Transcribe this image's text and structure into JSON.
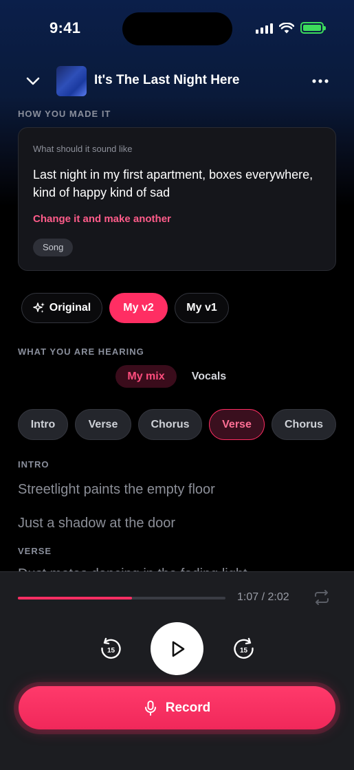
{
  "status_bar": {
    "time": "9:41"
  },
  "header": {
    "title": "It's The Last Night Here"
  },
  "how_you_made_it": {
    "label": "HOW YOU MADE IT",
    "question": "What should it sound like",
    "prompt": "Last night in my first apartment, boxes everywhere, kind of happy kind of sad",
    "change_link": "Change it and make another",
    "tag": "Song"
  },
  "versions": [
    {
      "label": "Original",
      "active": false
    },
    {
      "label": "My v2",
      "active": true
    },
    {
      "label": "My v1",
      "active": false
    }
  ],
  "hearing": {
    "label": "WHAT YOU ARE HEARING",
    "options": [
      {
        "label": "My mix",
        "active": true
      },
      {
        "label": "Vocals",
        "active": false
      }
    ]
  },
  "sections": [
    {
      "label": "Intro",
      "selected": false
    },
    {
      "label": "Verse",
      "selected": false
    },
    {
      "label": "Chorus",
      "selected": false
    },
    {
      "label": "Verse",
      "selected": true
    },
    {
      "label": "Chorus",
      "selected": false
    }
  ],
  "lyrics": {
    "intro_head": "INTRO",
    "intro_lines": [
      "Streetlight paints the empty floor",
      "Just a shadow at the door"
    ],
    "verse_head": "VERSE",
    "verse_partial": "Dust motes dancing in the fading light"
  },
  "player": {
    "progress": 0.55,
    "time": "1:07 / 2:02",
    "skip_back_seconds": "15",
    "skip_forward_seconds": "15",
    "record_label": "Record"
  },
  "colors": {
    "accent": "#ff2e63",
    "accent_text": "#ff5c8a",
    "battery": "#3ddc5c",
    "panel": "#1c1d21"
  },
  "icons": {
    "chevron": "chevron-down-icon",
    "more": "more-horizontal-icon",
    "sparkle": "sparkle-icon",
    "repeat": "repeat-icon",
    "skip_back": "skip-back-15-icon",
    "skip_forward": "skip-forward-15-icon",
    "play": "play-icon",
    "mic": "microphone-icon"
  }
}
